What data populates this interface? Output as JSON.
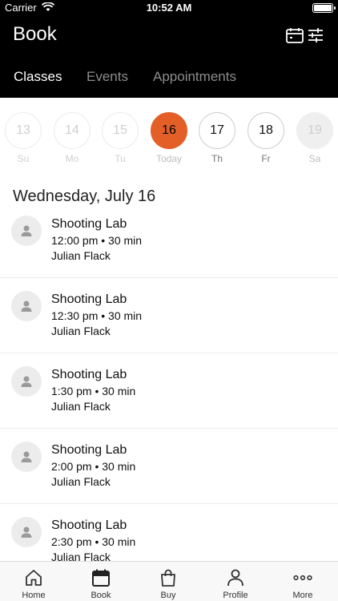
{
  "status_bar": {
    "carrier": "Carrier",
    "time": "10:52 AM"
  },
  "header": {
    "title": "Book"
  },
  "tabs": [
    {
      "label": "Classes",
      "active": true
    },
    {
      "label": "Events",
      "active": false
    },
    {
      "label": "Appointments",
      "active": false
    }
  ],
  "days": [
    {
      "num": "13",
      "label": "Su",
      "state": "faded"
    },
    {
      "num": "14",
      "label": "Mo",
      "state": "faded"
    },
    {
      "num": "15",
      "label": "Tu",
      "state": "faded"
    },
    {
      "num": "16",
      "label": "Today",
      "state": "today"
    },
    {
      "num": "17",
      "label": "Th",
      "state": "normal"
    },
    {
      "num": "18",
      "label": "Fr",
      "state": "normal"
    },
    {
      "num": "19",
      "label": "Sa",
      "state": "disabled"
    }
  ],
  "date_heading": "Wednesday, July 16",
  "classes": [
    {
      "name": "Shooting Lab",
      "time": "12:00 pm • 30 min",
      "instructor": "Julian Flack"
    },
    {
      "name": "Shooting Lab",
      "time": "12:30 pm • 30 min",
      "instructor": "Julian Flack"
    },
    {
      "name": "Shooting Lab",
      "time": "1:30 pm • 30 min",
      "instructor": "Julian Flack"
    },
    {
      "name": "Shooting Lab",
      "time": "2:00 pm • 30 min",
      "instructor": "Julian Flack"
    },
    {
      "name": "Shooting Lab",
      "time": "2:30 pm • 30 min",
      "instructor": "Julian Flack"
    }
  ],
  "tabbar": [
    {
      "label": "Home",
      "icon": "home-icon"
    },
    {
      "label": "Book",
      "icon": "calendar-icon"
    },
    {
      "label": "Buy",
      "icon": "shopping-bag-icon"
    },
    {
      "label": "Profile",
      "icon": "person-icon"
    },
    {
      "label": "More",
      "icon": "ellipsis-icon"
    }
  ],
  "colors": {
    "accent": "#e35f27",
    "header_bg": "#000000"
  }
}
